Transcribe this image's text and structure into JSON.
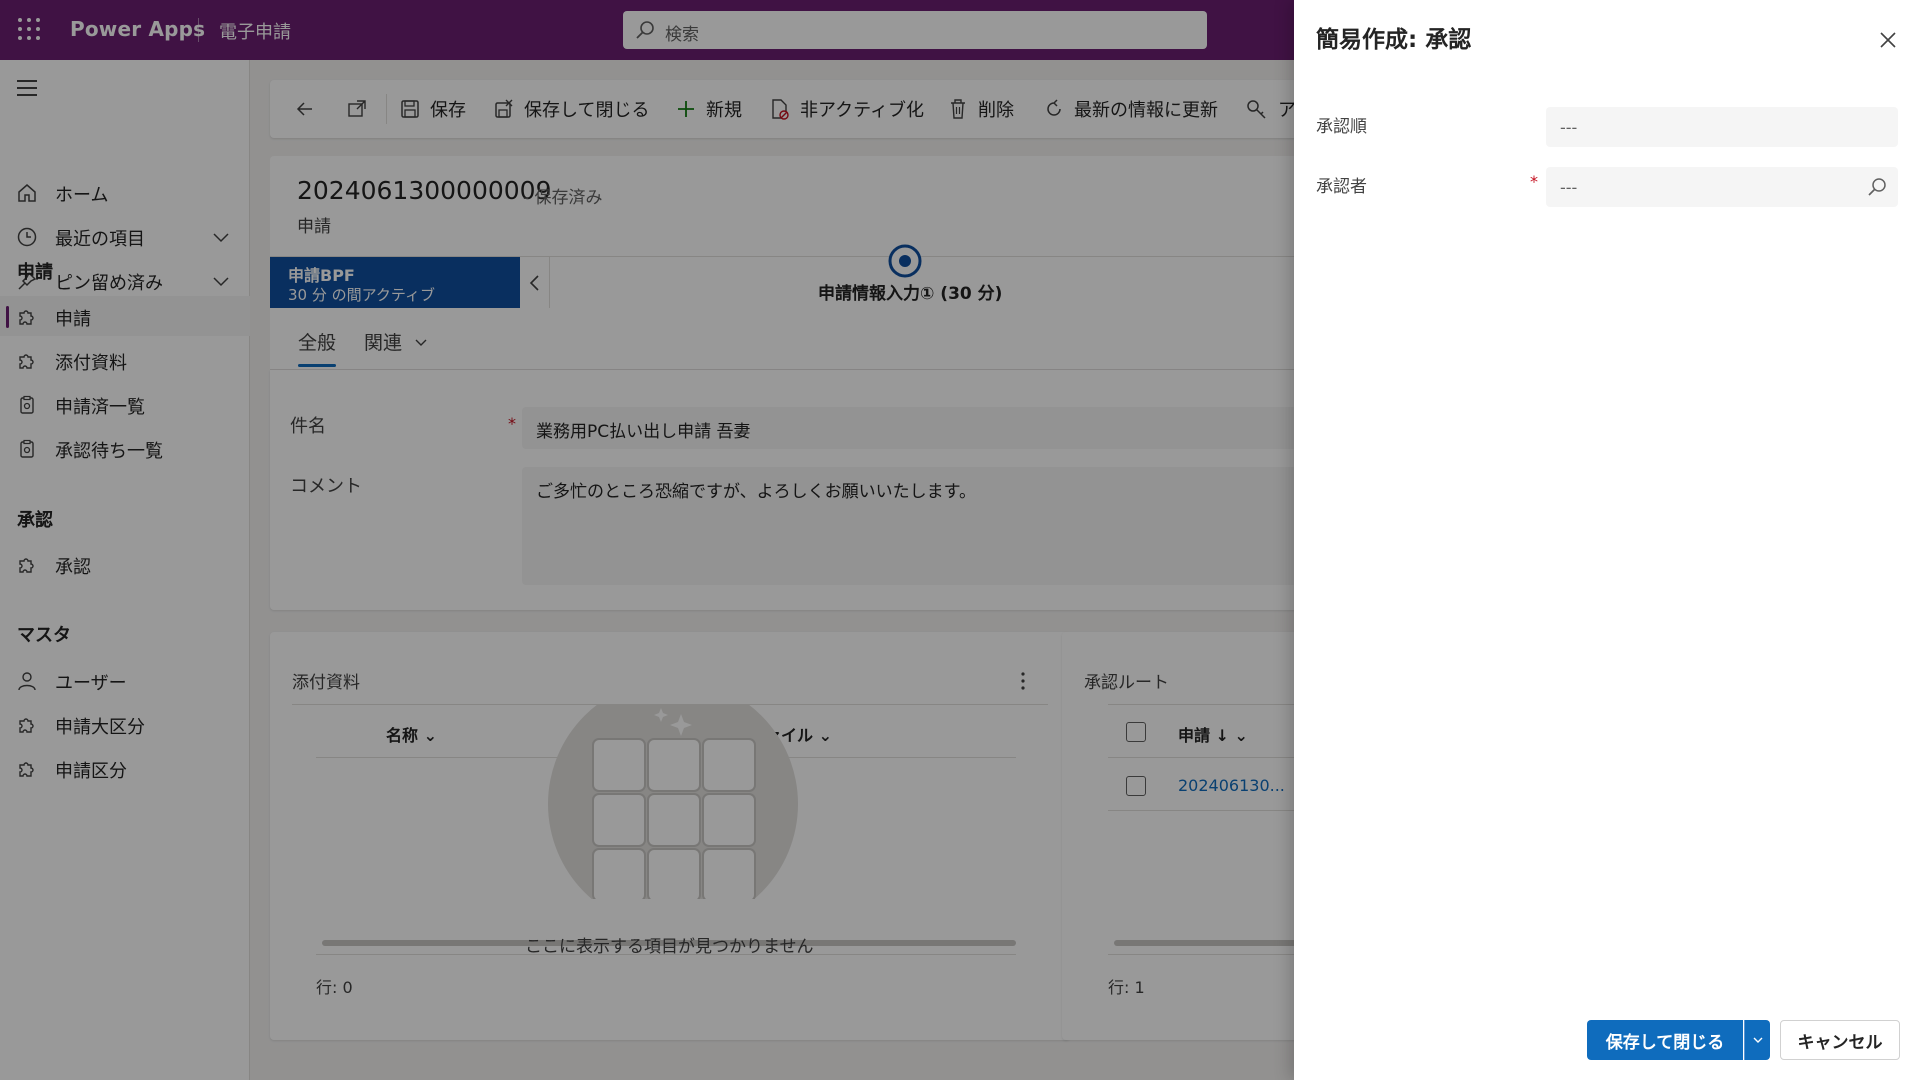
{
  "topbar": {
    "brand": "Power Apps",
    "app_name": "電子申請",
    "search_placeholder": "検索"
  },
  "nav": {
    "home": "ホーム",
    "recent": "最近の項目",
    "pinned": "ピン留め済み",
    "group_apply": "申請",
    "items_apply": [
      "申請",
      "添付資料",
      "申請済一覧",
      "承認待ち一覧"
    ],
    "group_approve": "承認",
    "items_approve": [
      "承認"
    ],
    "group_master": "マスタ",
    "items_master": [
      "ユーザー",
      "申請大区分",
      "申請区分"
    ]
  },
  "commands": {
    "save": "保存",
    "save_close": "保存して閉じる",
    "new": "新規",
    "deactivate": "非アクティブ化",
    "delete": "削除",
    "refresh": "最新の情報に更新",
    "more": "ア"
  },
  "record": {
    "id": "2024061300000009",
    "status": "- 保存済み",
    "entity": "申請"
  },
  "bpf": {
    "name": "申請BPF",
    "sub": "30 分 の間アクティブ",
    "stage": "申請情報入力① (30 分)"
  },
  "tabs": {
    "general": "全般",
    "related": "関連"
  },
  "form": {
    "subject_label": "件名",
    "subject_value": "業務用PC払い出し申請 吾妻",
    "comment_label": "コメント",
    "comment_value": "ご多忙のところ恐縮ですが、よろしくお願いいたします。"
  },
  "attachments": {
    "title": "添付資料",
    "col_name": "名称",
    "col_file": "ァイル",
    "empty": "ここに表示する項目が見つかりません",
    "row_count": "行: 0"
  },
  "route": {
    "title": "承認ルート",
    "col_apply": "申請 ↓",
    "row_value": "202406130...",
    "row_count": "行: 1"
  },
  "quick_create": {
    "title": "簡易作成: 承認",
    "order_label": "承認順",
    "order_value": "---",
    "approver_label": "承認者",
    "approver_value": "---",
    "save_close": "保存して閉じる",
    "cancel": "キャンセル"
  },
  "colors": {
    "topbar": "#6b1f72",
    "bpf": "#0f4f9e",
    "primary": "#0f6cbd"
  }
}
